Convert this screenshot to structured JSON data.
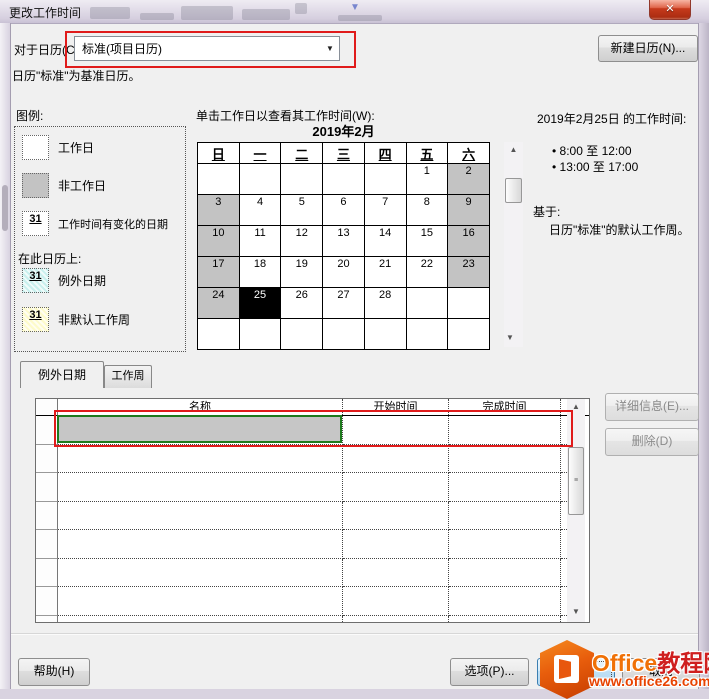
{
  "window": {
    "title": "更改工作时间"
  },
  "icons": {
    "close": "✕",
    "dropdown": "▼",
    "arrow_up": "▲",
    "arrow_down": "▼",
    "grip": "≡",
    "bullet": "•",
    "ghost_dropdown": "▼"
  },
  "header": {
    "for_calendar_label": "对于日历(C):",
    "calendar_value": "标准(项目日历)",
    "new_calendar_button": "新建日历(N)...",
    "base_note": "日历\"标准\"为基准日历。"
  },
  "legend": {
    "title": "图例:",
    "items": [
      {
        "key": "working",
        "label": "工作日",
        "badge": ""
      },
      {
        "key": "nonworking",
        "label": "非工作日",
        "badge": ""
      },
      {
        "key": "edited",
        "label": "工作时间有变化的日期",
        "badge": "31"
      },
      {
        "key": "subheader",
        "label": "在此日历上:",
        "badge": ""
      },
      {
        "key": "exception",
        "label": "例外日期",
        "badge": "31"
      },
      {
        "key": "nondefault",
        "label": "非默认工作周",
        "badge": "31"
      }
    ]
  },
  "calendar": {
    "hint": "单击工作日以查看其工作时间(W):",
    "month_title": "2019年2月",
    "day_headers": [
      "日",
      "一",
      "二",
      "三",
      "四",
      "五",
      "六"
    ],
    "weeks": [
      [
        {
          "d": "",
          "s": "e"
        },
        {
          "d": "",
          "s": "e"
        },
        {
          "d": "",
          "s": "e"
        },
        {
          "d": "",
          "s": "e"
        },
        {
          "d": "",
          "s": "e"
        },
        {
          "d": "1",
          "s": "w"
        },
        {
          "d": "2",
          "s": "n"
        }
      ],
      [
        {
          "d": "3",
          "s": "n"
        },
        {
          "d": "4",
          "s": "w"
        },
        {
          "d": "5",
          "s": "w"
        },
        {
          "d": "6",
          "s": "w"
        },
        {
          "d": "7",
          "s": "w"
        },
        {
          "d": "8",
          "s": "w"
        },
        {
          "d": "9",
          "s": "n"
        }
      ],
      [
        {
          "d": "10",
          "s": "n"
        },
        {
          "d": "11",
          "s": "w"
        },
        {
          "d": "12",
          "s": "w"
        },
        {
          "d": "13",
          "s": "w"
        },
        {
          "d": "14",
          "s": "w"
        },
        {
          "d": "15",
          "s": "w"
        },
        {
          "d": "16",
          "s": "n"
        }
      ],
      [
        {
          "d": "17",
          "s": "n"
        },
        {
          "d": "18",
          "s": "w"
        },
        {
          "d": "19",
          "s": "w"
        },
        {
          "d": "20",
          "s": "w"
        },
        {
          "d": "21",
          "s": "w"
        },
        {
          "d": "22",
          "s": "w"
        },
        {
          "d": "23",
          "s": "n"
        }
      ],
      [
        {
          "d": "24",
          "s": "n"
        },
        {
          "d": "25",
          "s": "x"
        },
        {
          "d": "26",
          "s": "w"
        },
        {
          "d": "27",
          "s": "w"
        },
        {
          "d": "28",
          "s": "w"
        },
        {
          "d": "",
          "s": "e"
        },
        {
          "d": "",
          "s": "e"
        }
      ],
      [
        {
          "d": "",
          "s": "e"
        },
        {
          "d": "",
          "s": "e"
        },
        {
          "d": "",
          "s": "e"
        },
        {
          "d": "",
          "s": "e"
        },
        {
          "d": "",
          "s": "e"
        },
        {
          "d": "",
          "s": "e"
        },
        {
          "d": "",
          "s": "e"
        }
      ]
    ]
  },
  "details": {
    "worktime_title": "2019年2月25日 的工作时间:",
    "worktimes": [
      "8:00 至 12:00",
      "13:00 至 17:00"
    ],
    "based_on_label": "基于:",
    "based_on_value": "日历\"标准\"的默认工作周。"
  },
  "tabs": [
    {
      "label": "例外日期",
      "active": true
    },
    {
      "label": "工作周",
      "active": false
    }
  ],
  "table": {
    "columns": [
      "名称",
      "开始时间",
      "完成时间"
    ],
    "row_count": 8,
    "rows": [
      [
        "",
        "",
        ""
      ],
      [
        "",
        "",
        ""
      ],
      [
        "",
        "",
        ""
      ],
      [
        "",
        "",
        ""
      ],
      [
        "",
        "",
        ""
      ],
      [
        "",
        "",
        ""
      ],
      [
        "",
        "",
        ""
      ],
      [
        "",
        "",
        ""
      ]
    ]
  },
  "buttons": {
    "details": "详细信息(E)...",
    "delete": "删除(D)",
    "help": "帮助(H)",
    "options": "选项(P)...",
    "ok": "确定",
    "cancel": "取消"
  },
  "watermark": {
    "brand": "Office",
    "brand_suffix": "教程网",
    "url": "www.office26.com"
  },
  "colors": {
    "annotation_red": "#e01b1b",
    "selection_green": "#1e7a1e",
    "nonworking_gray": "#c3c3c3",
    "selected_day_black": "#000000",
    "brand_orange": "#e8570e",
    "titlebar_lavender": "#d6cfdf"
  }
}
